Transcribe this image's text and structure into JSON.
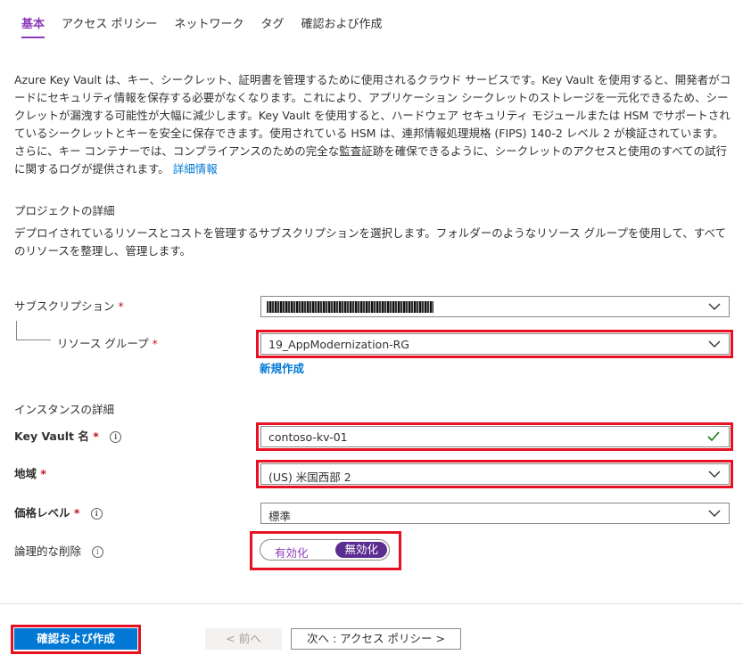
{
  "tabs": [
    {
      "label": "基本"
    },
    {
      "label": "アクセス ポリシー"
    },
    {
      "label": "ネットワーク"
    },
    {
      "label": "タグ"
    },
    {
      "label": "確認および作成"
    }
  ],
  "description": {
    "text": "Azure Key Vault は、キー、シークレット、証明書を管理するために使用されるクラウド サービスです。Key Vault を使用すると、開発者がコードにセキュリティ情報を保存する必要がなくなります。これにより、アプリケーション シークレットのストレージを一元化できるため、シークレットが漏洩する可能性が大幅に減少します。Key Vault を使用すると、ハードウェア セキュリティ モジュールまたは HSM でサポートされているシークレットとキーを安全に保存できます。使用されている HSM は、連邦情報処理規格 (FIPS) 140-2 レベル 2 が検証されています。さらに、キー コンテナーでは、コンプライアンスのための完全な監査証跡を確保できるように、シークレットのアクセスと使用のすべての試行に関するログが提供されます。",
    "link": "詳細情報"
  },
  "project": {
    "title": "プロジェクトの詳細",
    "desc": "デプロイされているリソースとコストを管理するサブスクリプションを選択します。フォルダーのようなリソース グループを使用して、すべてのリソースを整理し、管理します。",
    "subscription_label": "サブスクリプション",
    "rg_label": "リソース グループ",
    "rg_value": "19_AppModernization-RG",
    "new_link": "新規作成"
  },
  "instance": {
    "title": "インスタンスの詳細",
    "name_label": "Key Vault 名",
    "name_value": "contoso-kv-01",
    "region_label": "地域",
    "region_value": "(US) 米国西部 2",
    "tier_label": "価格レベル",
    "tier_value": "標準",
    "softdelete_label": "論理的な削除",
    "softdelete_on": "有効化",
    "softdelete_off": "無効化",
    "softdelete_selected": "無効化"
  },
  "required_mark": "*",
  "info_glyph": "i",
  "footer": {
    "review_create": "確認および作成",
    "prev": "< 前へ",
    "next": "次へ : アクセス ポリシー >"
  },
  "colors": {
    "accent_purple": "#8a3bb8",
    "toggle_selected": "#5c2d91",
    "primary_blue": "#0078d4",
    "highlight_red": "#e81123",
    "valid_green": "#107c10"
  },
  "icons": {
    "dropdown": "chevron-down-icon",
    "valid": "checkmark-icon",
    "info": "info-icon"
  }
}
